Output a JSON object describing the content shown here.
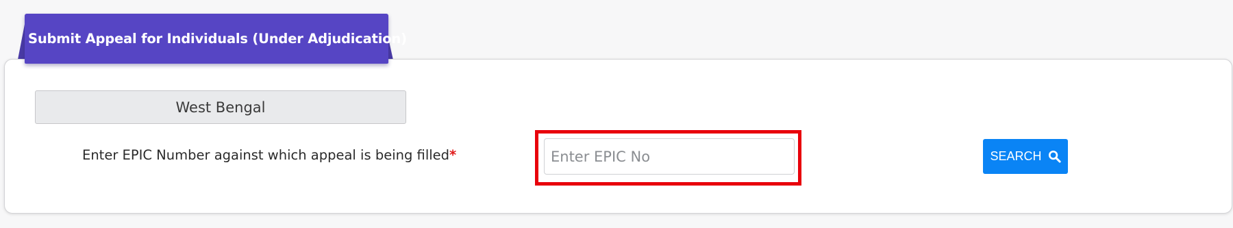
{
  "tab": {
    "title": "Submit Appeal for Individuals (Under Adjudication)"
  },
  "form": {
    "state_value": "West Bengal",
    "epic_label": "Enter EPIC Number against which appeal is being filled",
    "required_marker": "*",
    "epic_input": {
      "value": "",
      "placeholder": "Enter EPIC No"
    },
    "search_label": "SEARCH",
    "search_icon": "search-icon"
  },
  "colors": {
    "tab_background": "#5645c4",
    "search_button": "#0a84f5",
    "highlight_border": "#e8000b",
    "required_marker": "#e01b1b"
  }
}
